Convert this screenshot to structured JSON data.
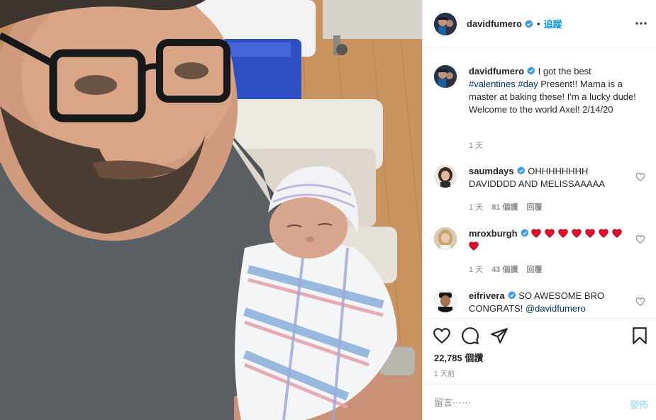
{
  "post_header": {
    "username": "davidfumero",
    "separator": "•",
    "follow_label": "追蹤",
    "more_icon": "more-horizontal-icon"
  },
  "caption": {
    "username": "davidfumero",
    "text_1": " I got the best ",
    "hashtag_1": "#valentines",
    "space": " ",
    "hashtag_2": "#day",
    "text_2": " Present!! Mama is a master at baking these! I'm a lucky dude! Welcome to the world Axel! 2/14/20",
    "time": "1 天"
  },
  "comments": [
    {
      "username": "saumdays",
      "text": "OHHHHHHHH DAVIDDDD AND MELISSAAAAA",
      "time": "1 天",
      "likes": "81 個讚",
      "reply": "回覆"
    },
    {
      "username": "mroxburgh",
      "hearts": [
        "red-heart-emoji",
        "red-heart-emoji",
        "red-heart-emoji",
        "red-heart-emoji",
        "red-heart-emoji",
        "red-heart-emoji",
        "red-heart-emoji",
        "red-heart-emoji"
      ],
      "time": "1 天",
      "likes": "43 個讚",
      "reply": "回覆"
    },
    {
      "username": "eifrivera",
      "text_1": "SO AWESOME BRO CONGRATS! ",
      "mention": "@davidfumero"
    }
  ],
  "actions": {
    "like_icon": "heart-icon",
    "comment_icon": "comment-icon",
    "share_icon": "paper-plane-icon",
    "save_icon": "bookmark-icon",
    "likes_count": "22,785 個讚",
    "posted": "1 天前"
  },
  "add_comment": {
    "placeholder": "留言⋯⋯",
    "post_label": "發佈"
  },
  "colors": {
    "link_blue": "#0095f6",
    "hashtag": "#00376b",
    "meta_gray": "#8e8e8e",
    "verified_blue": "#3897f0",
    "heart_red": "#e0102a",
    "post_disabled": "#b2dffc"
  }
}
